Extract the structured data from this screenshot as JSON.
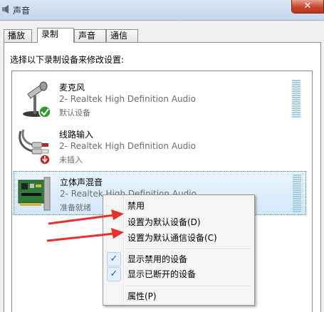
{
  "window": {
    "title": "声音",
    "close_glyph": "✕"
  },
  "tabs": [
    "播放",
    "录制",
    "声音",
    "通信"
  ],
  "active_tab": "录制",
  "instruction": "选择以下录制设备来修改设置:",
  "devices": [
    {
      "name": "麦克风",
      "driver": "2- Realtek High Definition Audio",
      "status": "默认设备",
      "icon": "microphone-icon",
      "badge": "default-check-badge",
      "badge_color": "#2e9b2e"
    },
    {
      "name": "线路输入",
      "driver": "2- Realtek High Definition Audio",
      "status": "未插入",
      "icon": "line-in-cable-icon",
      "badge": "unplugged-badge",
      "badge_color": "#c1272d"
    },
    {
      "name": "立体声混音",
      "driver": "2- Realtek High Definition Audio",
      "status": "准备就绪",
      "icon": "sound-card-icon",
      "selected": true
    }
  ],
  "context_menu": {
    "items": [
      {
        "label": "禁用"
      },
      {
        "label": "设置为默认设备(D)"
      },
      {
        "label": "设置为默认通信设备(C)"
      },
      {
        "label": "显示禁用的设备",
        "checked": true
      },
      {
        "label": "显示已断开的设备",
        "checked": true
      },
      {
        "label": "属性(P)"
      }
    ],
    "check_glyph": "✓"
  },
  "annotation_color": "#e8312c"
}
